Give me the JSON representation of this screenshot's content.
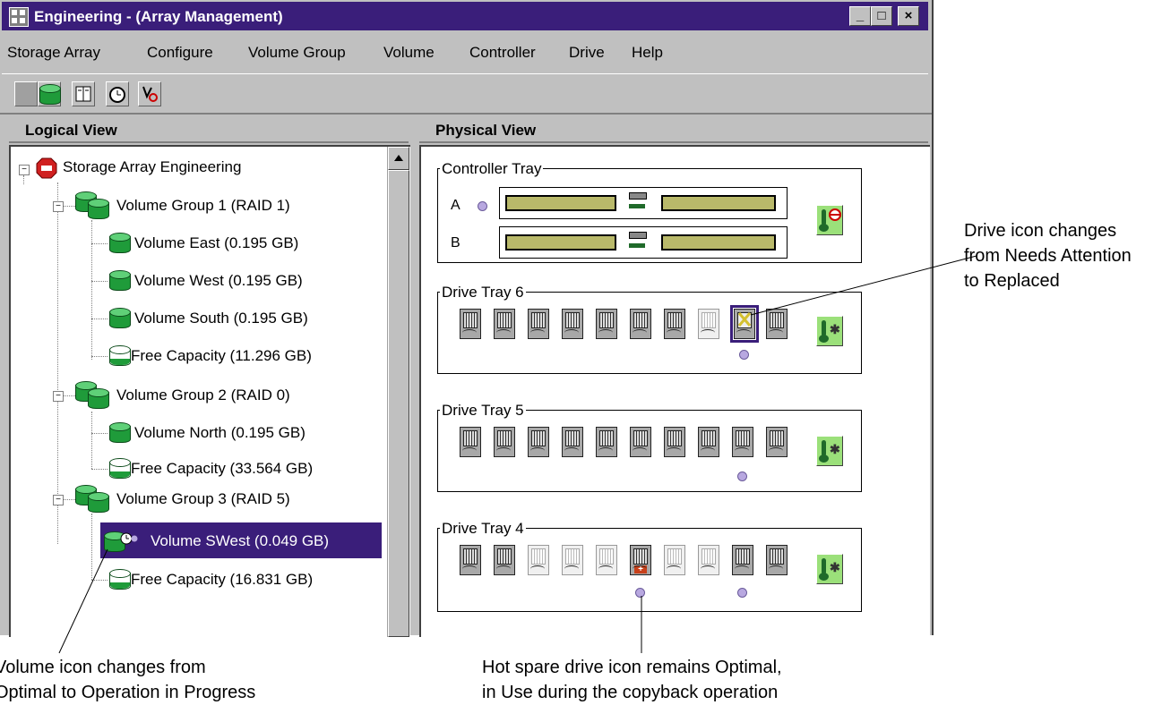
{
  "window": {
    "title": "Engineering - (Array Management)",
    "controls": {
      "minimize": "_",
      "maximize": "□",
      "close": "×"
    }
  },
  "menu": [
    {
      "label": "Storage Array",
      "mnemonic": "S"
    },
    {
      "label": "Configure",
      "mnemonic": "f"
    },
    {
      "label": "Volume Group",
      "mnemonic": "G"
    },
    {
      "label": "Volume",
      "mnemonic": "o"
    },
    {
      "label": "Controller",
      "mnemonic": "C"
    },
    {
      "label": "Drive",
      "mnemonic": "D"
    },
    {
      "label": "Help",
      "mnemonic": "H"
    }
  ],
  "toolbar_icons": [
    "array-disabled-icon",
    "volume-icon",
    "book-icon",
    "clock-icon",
    "stethoscope-icon"
  ],
  "logical_view": {
    "header": "Logical View",
    "root": "Storage Array Engineering",
    "nodes": [
      "Volume Group 1 (RAID 1)",
      "Volume East  (0.195 GB)",
      "Volume West  (0.195 GB)",
      "Volume South  (0.195 GB)",
      "Free Capacity (11.296 GB)",
      "Volume Group 2 (RAID 0)",
      "Volume North  (0.195 GB)",
      "Free Capacity (33.564 GB)",
      "Volume Group 3 (RAID 5)",
      "Volume SWest  (0.049 GB)",
      "Free Capacity (16.831 GB)"
    ]
  },
  "physical_view": {
    "header": "Physical View",
    "controller_tray": {
      "label": "Controller Tray",
      "slots": [
        "A",
        "B"
      ]
    },
    "drive_trays": [
      {
        "label": "Drive Tray 6"
      },
      {
        "label": "Drive Tray 5"
      },
      {
        "label": "Drive Tray 4"
      }
    ]
  },
  "annotations": {
    "drive_replaced": "Drive icon changes\nfrom Needs Attention\nto Replaced",
    "volume_progress": "Volume icon changes from\nOptimal to Operation in Progress",
    "hot_spare": "Hot spare drive icon remains Optimal,\nin Use during the copyback operation"
  },
  "colors": {
    "titlebar": "#3a1e7a",
    "selection": "#3a1e7a",
    "volume_green": "#1f9b3a"
  }
}
